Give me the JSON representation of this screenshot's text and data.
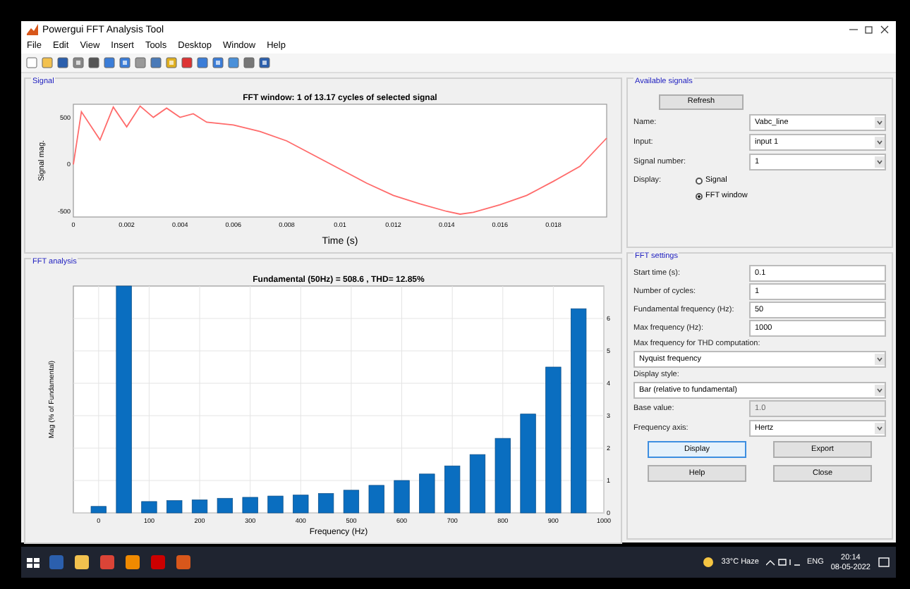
{
  "window": {
    "title": "Powergui FFT Analysis Tool"
  },
  "menu": [
    "File",
    "Edit",
    "View",
    "Insert",
    "Tools",
    "Desktop",
    "Window",
    "Help"
  ],
  "signal_panel": {
    "title": "Signal",
    "chart_data": {
      "type": "line",
      "title": "FFT window: 1 of 13.17 cycles of selected signal",
      "xlabel": "Time (s)",
      "ylabel": "Signal mag.",
      "xlim": [
        0,
        0.02
      ],
      "ylim": [
        -560,
        640
      ],
      "xticks": [
        0,
        0.002,
        0.004,
        0.006,
        0.008,
        0.01,
        0.012,
        0.014,
        0.016,
        0.018
      ],
      "yticks": [
        -500,
        0,
        500
      ],
      "x": [
        0,
        0.0003,
        0.001,
        0.0015,
        0.002,
        0.0025,
        0.003,
        0.0035,
        0.004,
        0.0045,
        0.005,
        0.006,
        0.007,
        0.008,
        0.009,
        0.01,
        0.011,
        0.012,
        0.013,
        0.014,
        0.0145,
        0.015,
        0.016,
        0.017,
        0.018,
        0.019,
        0.02
      ],
      "series": [
        {
          "color": "#ff6b6b",
          "values": [
            0,
            560,
            260,
            610,
            400,
            620,
            500,
            600,
            500,
            540,
            450,
            420,
            350,
            250,
            100,
            -50,
            -200,
            -330,
            -420,
            -500,
            -530,
            -510,
            -430,
            -330,
            -180,
            -20,
            280
          ]
        }
      ]
    }
  },
  "analysis_panel": {
    "title": "FFT analysis",
    "chart_data": {
      "type": "bar",
      "title": "Fundamental (50Hz) = 508.6 , THD= 12.85%",
      "xlabel": "Frequency (Hz)",
      "ylabel": "Mag (% of Fundamental)",
      "xlim": [
        -50,
        1000
      ],
      "ylim": [
        0,
        7
      ],
      "xticks": [
        0,
        100,
        200,
        300,
        400,
        500,
        600,
        700,
        800,
        900,
        1000
      ],
      "yticks": [
        0,
        1,
        2,
        3,
        4,
        5,
        6
      ],
      "x": [
        0,
        50,
        100,
        150,
        200,
        250,
        300,
        350,
        400,
        450,
        500,
        550,
        600,
        650,
        700,
        750,
        800,
        850,
        900,
        950
      ],
      "grid": true,
      "series": [
        {
          "color": "#0a6ec0",
          "values": [
            0.2,
            7,
            0.35,
            0.38,
            0.4,
            0.45,
            0.48,
            0.52,
            0.55,
            0.6,
            0.7,
            0.85,
            1.0,
            1.2,
            1.45,
            1.8,
            2.3,
            3.05,
            4.5,
            6.3
          ]
        }
      ]
    }
  },
  "available_signals": {
    "title": "Available signals",
    "refresh": "Refresh",
    "fields": [
      {
        "label": "Name:",
        "value": "Vabc_line",
        "kind": "dropdown"
      },
      {
        "label": "Input:",
        "value": "input 1",
        "kind": "dropdown"
      },
      {
        "label": "Signal number:",
        "value": "1",
        "kind": "dropdown"
      }
    ],
    "display_label": "Display:",
    "display_options": [
      {
        "label": "Signal",
        "selected": false
      },
      {
        "label": "FFT window",
        "selected": true
      }
    ]
  },
  "fft_settings": {
    "title": "FFT settings",
    "fields": [
      {
        "label": "Start time (s):",
        "value": "0.1",
        "kind": "text",
        "disabled": false
      },
      {
        "label": "Number of cycles:",
        "value": "1",
        "kind": "text",
        "disabled": false
      },
      {
        "label": "Fundamental frequency (Hz):",
        "value": "50",
        "kind": "text",
        "disabled": false
      },
      {
        "label": "Max frequency (Hz):",
        "value": "1000",
        "kind": "text",
        "disabled": false
      },
      {
        "label": "Max frequency for THD computation:",
        "value": "Nyquist frequency",
        "kind": "stacked"
      },
      {
        "label": "Display style:",
        "value": "Bar (relative to fundamental)",
        "kind": "stacked"
      },
      {
        "label": "Base value:",
        "value": "1.0",
        "kind": "text",
        "disabled": true
      },
      {
        "label": "Frequency axis:",
        "value": "Hertz",
        "kind": "dropdown"
      }
    ],
    "buttons": [
      {
        "label": "Display",
        "focused": true
      },
      {
        "label": "Export",
        "focused": false
      },
      {
        "label": "Help",
        "focused": false
      },
      {
        "label": "Close",
        "focused": false
      }
    ]
  },
  "taskbar": {
    "weather": "33°C Haze",
    "language": "ENG",
    "time": "20:14",
    "date": "08-05-2022"
  }
}
